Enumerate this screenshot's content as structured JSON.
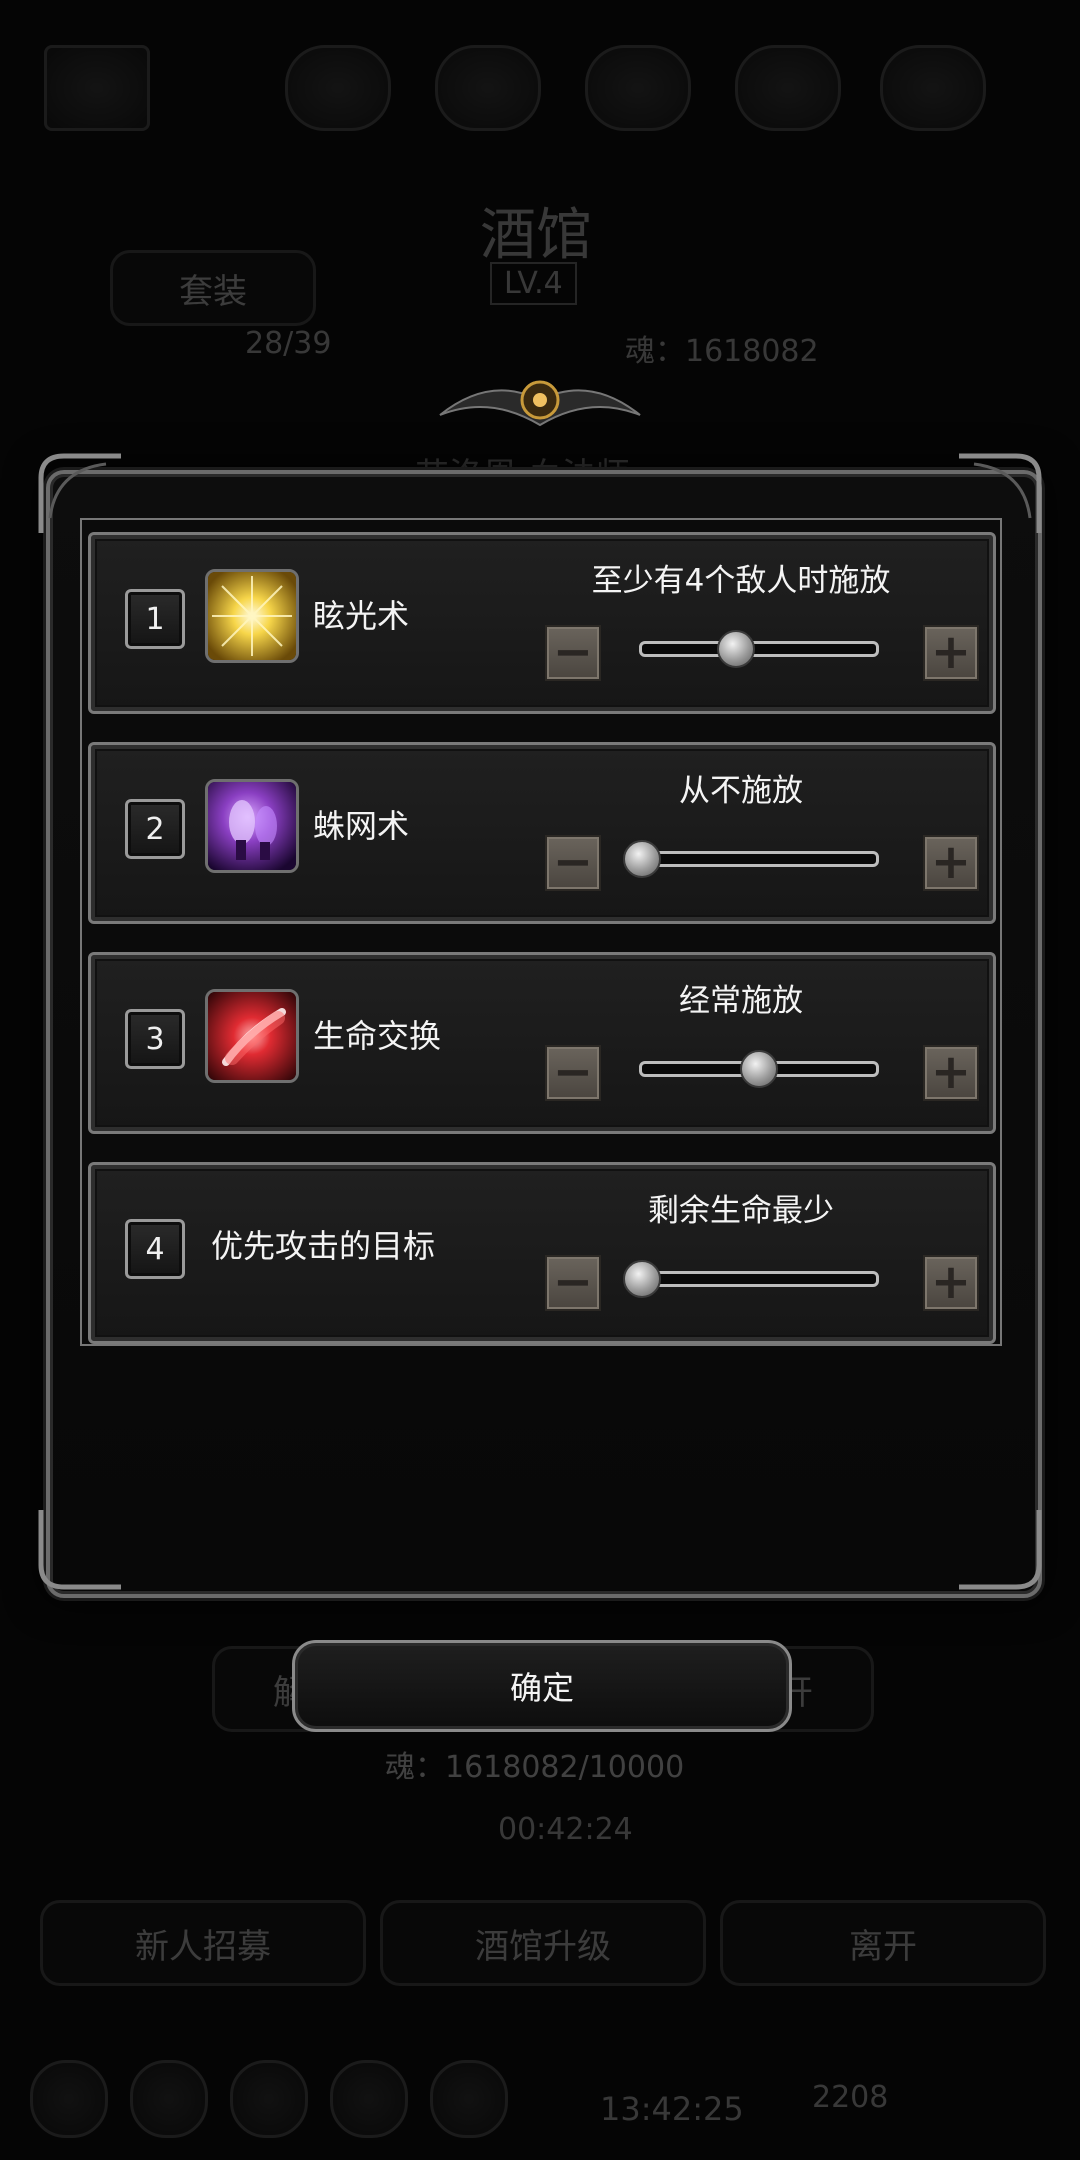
{
  "background": {
    "title": "酒馆",
    "suit_label": "套装",
    "level_badge": "LV.4",
    "hero_count": "28/39",
    "soul_header": "魂：1618082",
    "hero_name": "艾洛恩 血法师",
    "left_btn_label": "解",
    "right_btn_label": "开",
    "soul_footer": "魂：1618082/10000",
    "timer": "00:42:24",
    "recruit_label": "新人招募",
    "upgrade_label": "酒馆升级",
    "leave_label": "离开",
    "clock": "13:42:25",
    "gem_count": "2208"
  },
  "dialog": {
    "rows": [
      {
        "index": "1",
        "name": "眩光术",
        "option": "至少有4个敌人时施放",
        "level": 0.4,
        "icon": "glare-spell-icon",
        "icon_color": "#f2cf3a"
      },
      {
        "index": "2",
        "name": "蛛网术",
        "option": "从不施放",
        "level": 0.0,
        "icon": "web-spell-icon",
        "icon_color": "#8a3fc2"
      },
      {
        "index": "3",
        "name": "生命交换",
        "option": "经常施放",
        "level": 0.5,
        "icon": "life-swap-icon",
        "icon_color": "#d9202b"
      },
      {
        "index": "4",
        "name": "优先攻击的目标",
        "option": "剩余生命最少",
        "level": 0.0
      }
    ],
    "minus_symbol": "−",
    "plus_symbol": "+",
    "confirm_label": "确定"
  }
}
